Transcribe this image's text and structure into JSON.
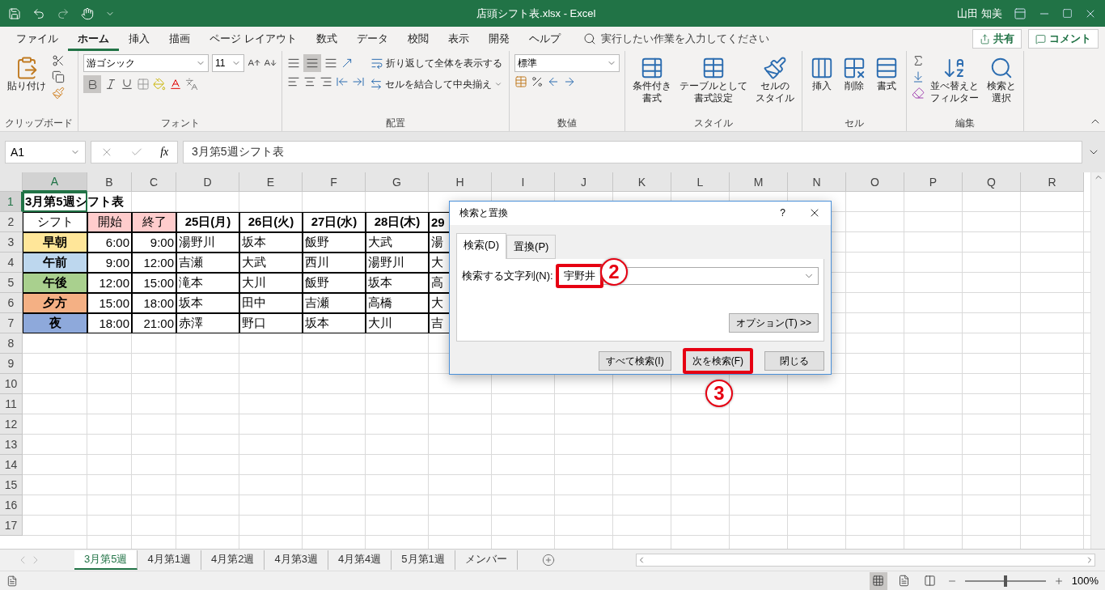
{
  "title_bar": {
    "title": "店頭シフト表.xlsx  -  Excel",
    "user": "山田 知美"
  },
  "menu": {
    "tabs": [
      {
        "label": "ファイル",
        "selected": false
      },
      {
        "label": "ホーム",
        "selected": true
      },
      {
        "label": "挿入",
        "selected": false
      },
      {
        "label": "描画",
        "selected": false
      },
      {
        "label": "ページ レイアウト",
        "selected": false
      },
      {
        "label": "数式",
        "selected": false
      },
      {
        "label": "データ",
        "selected": false
      },
      {
        "label": "校閲",
        "selected": false
      },
      {
        "label": "表示",
        "selected": false
      },
      {
        "label": "開発",
        "selected": false
      },
      {
        "label": "ヘルプ",
        "selected": false
      }
    ],
    "search_placeholder": "実行したい作業を入力してください",
    "share": "共有",
    "comment": "コメント"
  },
  "ribbon": {
    "groups": [
      {
        "kind": "clipboard",
        "label": "クリップボード",
        "paste": "貼り付け"
      },
      {
        "kind": "font",
        "label": "フォント",
        "font_name": "游ゴシック",
        "font_size": "11",
        "bold": true
      },
      {
        "kind": "alignment",
        "label": "配置",
        "wrap": "折り返して全体を表示する",
        "merge": "セルを結合して中央揃え"
      },
      {
        "kind": "number",
        "label": "数値",
        "format": "標準"
      },
      {
        "kind": "styles",
        "label": "スタイル",
        "buttons": [
          {
            "lines": [
              "条件付き",
              "書式"
            ]
          },
          {
            "lines": [
              "テーブルとして",
              "書式設定"
            ]
          },
          {
            "lines": [
              "セルの",
              "スタイル"
            ]
          }
        ]
      },
      {
        "kind": "cells",
        "label": "セル",
        "buttons": [
          {
            "lines": [
              "挿入"
            ]
          },
          {
            "lines": [
              "削除"
            ]
          },
          {
            "lines": [
              "書式"
            ]
          }
        ]
      },
      {
        "kind": "editing",
        "label": "編集",
        "buttons": [
          {
            "lines": [
              "並べ替えと",
              "フィルター"
            ]
          },
          {
            "lines": [
              "検索と",
              "選択"
            ]
          }
        ]
      }
    ]
  },
  "formula_bar": {
    "name_box": "A1",
    "function_label": "fx",
    "formula": "3月第5週シフト表"
  },
  "sheet": {
    "columns": [
      "A",
      "B",
      "C",
      "D",
      "E",
      "F",
      "G",
      "H",
      "I",
      "J",
      "K",
      "L",
      "M",
      "N",
      "O",
      "P",
      "Q",
      "R"
    ],
    "rows": [
      {
        "number": "1",
        "cells": [
          {
            "text": "3月第5週シフト表",
            "kind": "title"
          }
        ]
      },
      {
        "number": "2",
        "cells": [
          {
            "text": "シフト",
            "kind": "plain"
          },
          {
            "text": "開始",
            "kind": "plain",
            "color": "#ffcccc"
          },
          {
            "text": "終了",
            "kind": "plain",
            "color": "#ffcccc"
          },
          {
            "text": "25日(月)",
            "kind": "header"
          },
          {
            "text": "26日(火)",
            "kind": "header"
          },
          {
            "text": "27日(水)",
            "kind": "header"
          },
          {
            "text": "28日(木)",
            "kind": "header"
          },
          {
            "text": "29",
            "kind": "header"
          }
        ]
      },
      {
        "number": "3",
        "cells": [
          {
            "text": "早朝",
            "kind": "shift",
            "color": "#ffe699"
          },
          {
            "text": "6:00",
            "kind": "time"
          },
          {
            "text": "9:00",
            "kind": "time"
          },
          {
            "text": "湯野川",
            "kind": "name"
          },
          {
            "text": "坂本",
            "kind": "name"
          },
          {
            "text": "飯野",
            "kind": "name"
          },
          {
            "text": "大武",
            "kind": "name"
          },
          {
            "text": "湯",
            "kind": "name"
          }
        ]
      },
      {
        "number": "4",
        "cells": [
          {
            "text": "午前",
            "kind": "shift",
            "color": "#bdd7ee"
          },
          {
            "text": "9:00",
            "kind": "time"
          },
          {
            "text": "12:00",
            "kind": "time"
          },
          {
            "text": "吉瀬",
            "kind": "name"
          },
          {
            "text": "大武",
            "kind": "name"
          },
          {
            "text": "西川",
            "kind": "name"
          },
          {
            "text": "湯野川",
            "kind": "name"
          },
          {
            "text": "大",
            "kind": "name"
          }
        ]
      },
      {
        "number": "5",
        "cells": [
          {
            "text": "午後",
            "kind": "shift",
            "color": "#a9d08e"
          },
          {
            "text": "12:00",
            "kind": "time"
          },
          {
            "text": "15:00",
            "kind": "time"
          },
          {
            "text": "滝本",
            "kind": "name"
          },
          {
            "text": "大川",
            "kind": "name"
          },
          {
            "text": "飯野",
            "kind": "name"
          },
          {
            "text": "坂本",
            "kind": "name"
          },
          {
            "text": "高",
            "kind": "name"
          }
        ]
      },
      {
        "number": "6",
        "cells": [
          {
            "text": "夕方",
            "kind": "shift",
            "color": "#f4b084"
          },
          {
            "text": "15:00",
            "kind": "time"
          },
          {
            "text": "18:00",
            "kind": "time"
          },
          {
            "text": "坂本",
            "kind": "name"
          },
          {
            "text": "田中",
            "kind": "name"
          },
          {
            "text": "吉瀬",
            "kind": "name"
          },
          {
            "text": "高橋",
            "kind": "name"
          },
          {
            "text": "大",
            "kind": "name"
          }
        ]
      },
      {
        "number": "7",
        "cells": [
          {
            "text": "夜",
            "kind": "shift",
            "color": "#8ea9db"
          },
          {
            "text": "18:00",
            "kind": "time"
          },
          {
            "text": "21:00",
            "kind": "time"
          },
          {
            "text": "赤澤",
            "kind": "name"
          },
          {
            "text": "野口",
            "kind": "name"
          },
          {
            "text": "坂本",
            "kind": "name"
          },
          {
            "text": "大川",
            "kind": "name"
          },
          {
            "text": "吉",
            "kind": "name"
          }
        ]
      },
      {
        "number": "8"
      },
      {
        "number": "9"
      },
      {
        "number": "10"
      },
      {
        "number": "11"
      },
      {
        "number": "12"
      },
      {
        "number": "13"
      },
      {
        "number": "14"
      },
      {
        "number": "15"
      },
      {
        "number": "16"
      },
      {
        "number": "17"
      }
    ]
  },
  "dialog": {
    "title": "検索と置換",
    "help": "?",
    "tabs": [
      {
        "label": "検索(D)",
        "selected": true
      },
      {
        "label": "置換(P)",
        "selected": false
      }
    ],
    "field_label": "検索する文字列(N):",
    "value": "宇野井",
    "value_highlighted": true,
    "options": "オプション(T) >>",
    "buttons": [
      {
        "label": "すべて検索(I)",
        "highlighted": false
      },
      {
        "label": "次を検索(F)",
        "highlighted": true
      },
      {
        "label": "閉じる",
        "highlighted": false
      }
    ],
    "callouts": [
      {
        "label": "2"
      },
      {
        "label": "3"
      }
    ]
  },
  "sheet_tabs": [
    {
      "label": "3月第5週",
      "selected": true
    },
    {
      "label": "4月第1週",
      "selected": false
    },
    {
      "label": "4月第2週",
      "selected": false
    },
    {
      "label": "4月第3週",
      "selected": false
    },
    {
      "label": "4月第4週",
      "selected": false
    },
    {
      "label": "5月第1週",
      "selected": false
    },
    {
      "label": "メンバー",
      "selected": false
    }
  ],
  "status_bar": {
    "views": [
      {
        "selected": true
      },
      {
        "selected": false
      },
      {
        "selected": false
      }
    ],
    "zoom": "100%",
    "zoom_slider": {
      "level": 0.5
    }
  }
}
